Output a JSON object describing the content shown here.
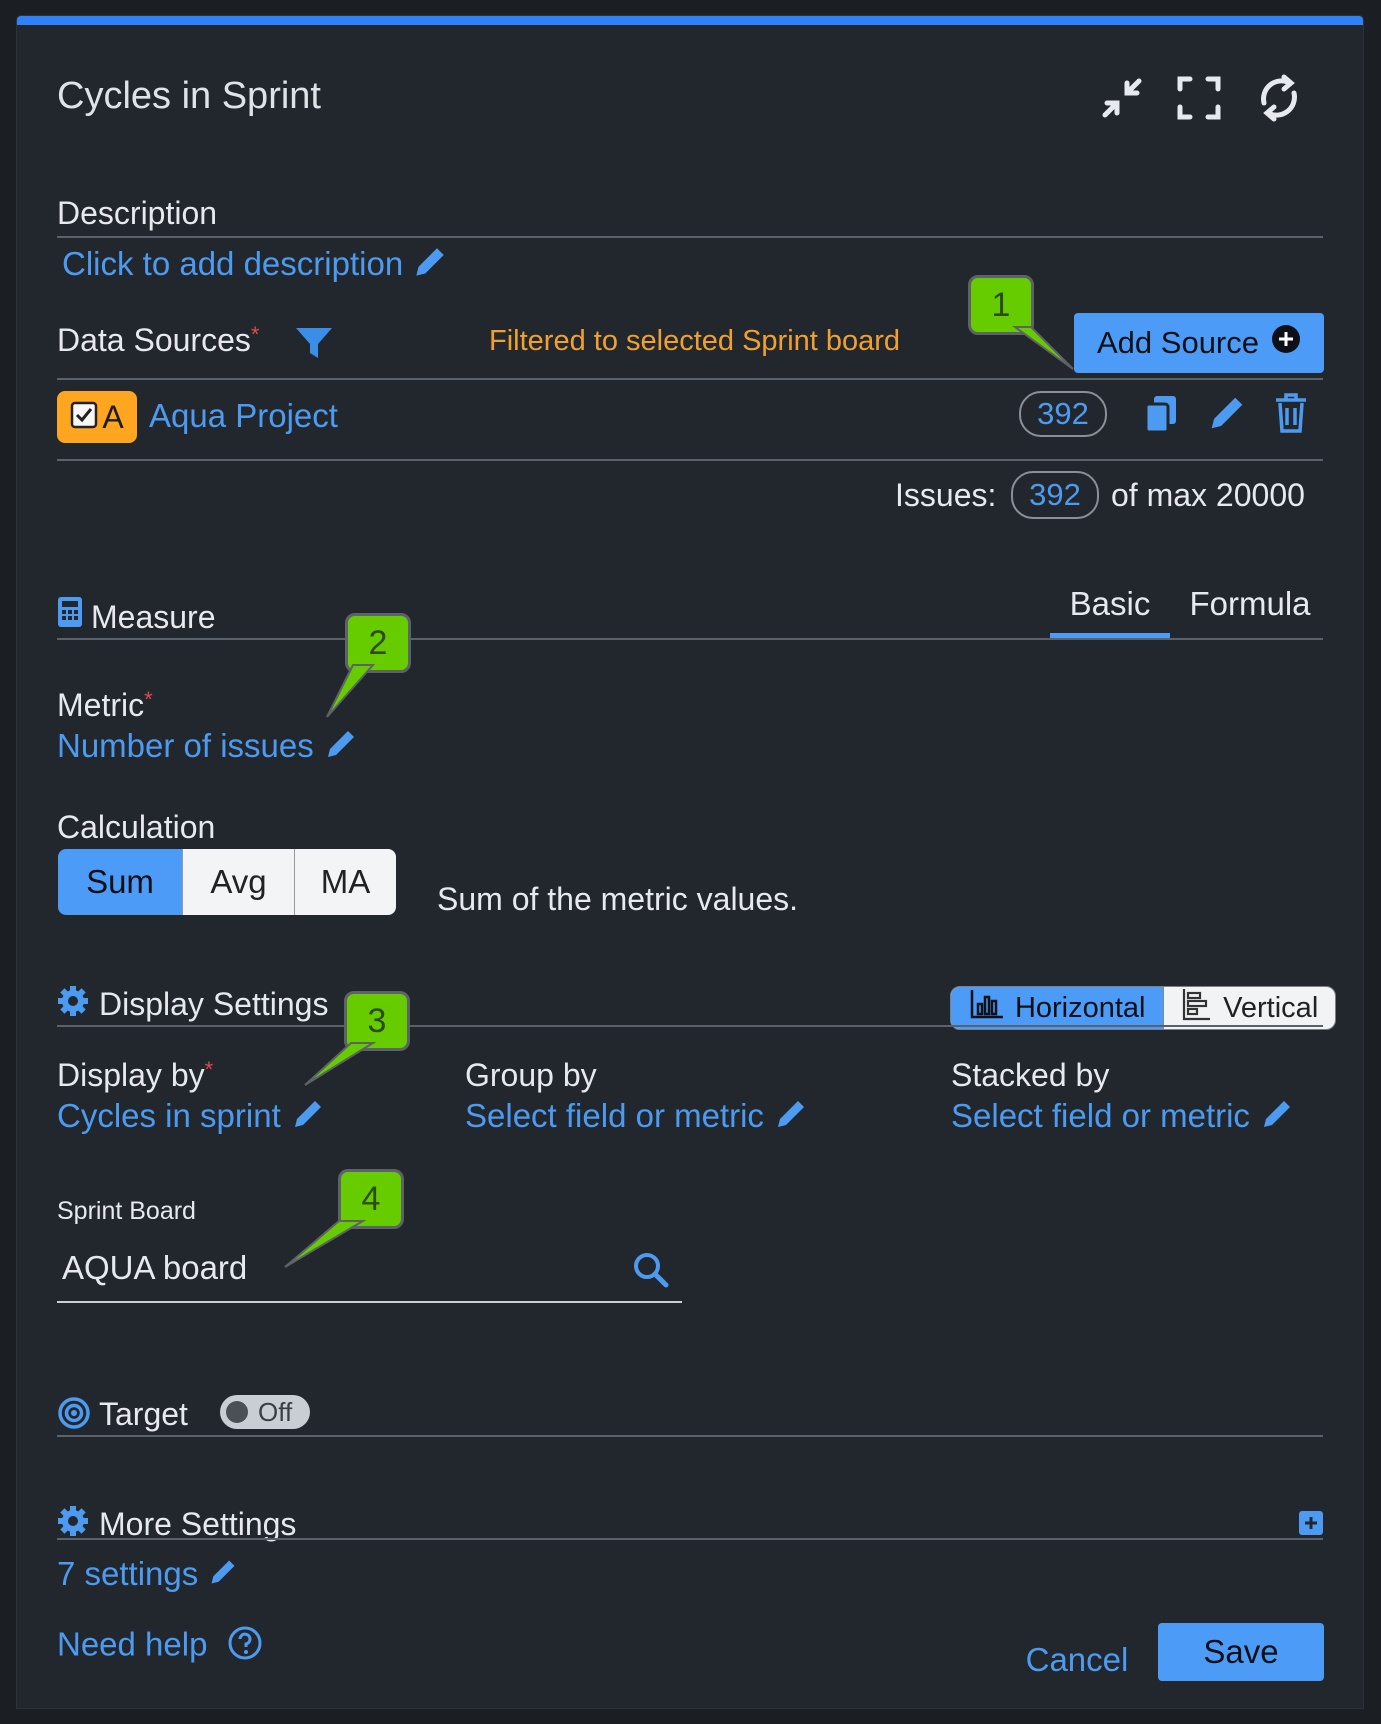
{
  "header": {
    "title": "Cycles in Sprint",
    "icons": [
      "collapse-icon",
      "fullscreen-icon",
      "refresh-icon"
    ]
  },
  "description": {
    "label": "Description",
    "link": "Click to add description"
  },
  "data_sources": {
    "label": "Data Sources",
    "filter_note": "Filtered to selected Sprint board",
    "add_button": "Add Source",
    "source": {
      "badge": "A",
      "name": "Aqua Project",
      "count": "392"
    },
    "issues_label": "Issues:",
    "issues_count": "392",
    "issues_max": "of max 20000"
  },
  "measure": {
    "label": "Measure",
    "tabs": [
      "Basic",
      "Formula"
    ],
    "active_tab": "Basic",
    "metric_label": "Metric",
    "metric_value": "Number of issues",
    "calc_label": "Calculation",
    "calc_options": [
      "Sum",
      "Avg",
      "MA"
    ],
    "calc_selected": "Sum",
    "calc_desc": "Sum of the metric values."
  },
  "display": {
    "label": "Display Settings",
    "orientation": [
      "Horizontal",
      "Vertical"
    ],
    "orientation_selected": "Horizontal",
    "display_by_label": "Display by",
    "display_by_value": "Cycles in sprint",
    "group_by_label": "Group by",
    "group_by_value": "Select field or metric",
    "stacked_by_label": "Stacked by",
    "stacked_by_value": "Select field or metric",
    "sprint_board_label": "Sprint Board",
    "sprint_board_value": "AQUA board"
  },
  "target": {
    "label": "Target",
    "toggle": "Off"
  },
  "more": {
    "label": "More Settings",
    "link": "7 settings"
  },
  "footer": {
    "help": "Need help",
    "cancel": "Cancel",
    "save": "Save"
  },
  "callouts": [
    "1",
    "2",
    "3",
    "4"
  ],
  "colors": {
    "accent": "#4c9bf7",
    "callout": "#66cc00",
    "warning": "#f0a030",
    "badge": "#ffa51f"
  }
}
